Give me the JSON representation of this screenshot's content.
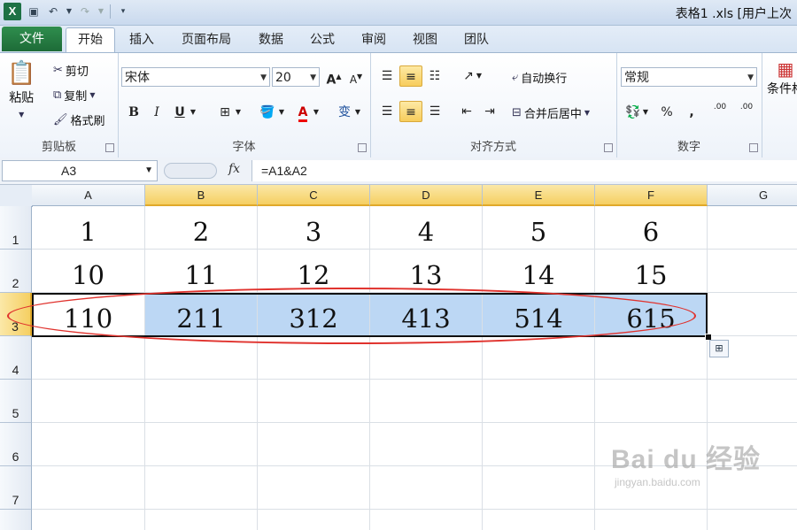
{
  "window": {
    "title": "表格1 .xls [用户上次",
    "app_icon": "X"
  },
  "ribbon_tabs": [
    {
      "label": "文件",
      "active": false
    },
    {
      "label": "开始",
      "active": true
    },
    {
      "label": "插入",
      "active": false
    },
    {
      "label": "页面布局",
      "active": false
    },
    {
      "label": "数据",
      "active": false
    },
    {
      "label": "公式",
      "active": false
    },
    {
      "label": "审阅",
      "active": false
    },
    {
      "label": "视图",
      "active": false
    },
    {
      "label": "团队",
      "active": false
    }
  ],
  "clipboard": {
    "group_label": "剪贴板",
    "paste": "粘贴",
    "cut": "剪切",
    "copy": "复制",
    "format_painter": "格式刷"
  },
  "font": {
    "group_label": "字体",
    "family": "宋体",
    "size": "20",
    "bold": "B",
    "italic": "I",
    "underline": "U",
    "grow": "A",
    "shrink": "A",
    "font_color_letter": "A",
    "phonetic": "变"
  },
  "alignment": {
    "group_label": "对齐方式",
    "wrap_text": "自动换行",
    "merge_center": "合并后居中"
  },
  "number": {
    "group_label": "数字",
    "format": "常规",
    "percent": "%",
    "comma": ",",
    "inc_decimal": ".00",
    "dec_decimal": ".00"
  },
  "styles": {
    "conditional": "条件格"
  },
  "formula_bar": {
    "name_box": "A3",
    "fx": "fx",
    "formula": "=A1&A2"
  },
  "columns": [
    "A",
    "B",
    "C",
    "D",
    "E",
    "F",
    "G"
  ],
  "rows": [
    "1",
    "2",
    "3",
    "4",
    "5",
    "6",
    "7"
  ],
  "cells": {
    "r1": [
      "1",
      "2",
      "3",
      "4",
      "5",
      "6"
    ],
    "r2": [
      "10",
      "11",
      "12",
      "13",
      "14",
      "15"
    ],
    "r3": [
      "110",
      "211",
      "312",
      "413",
      "514",
      "615"
    ]
  },
  "watermark": {
    "brand": "Bai du 经验",
    "url": "jingyan.baidu.com"
  },
  "colors": {
    "file_tab": "#1d6b37",
    "selection_highlight": "#bcd7f4",
    "annotation_ellipse": "#e0322d",
    "header_selected": "#f5cf62"
  }
}
